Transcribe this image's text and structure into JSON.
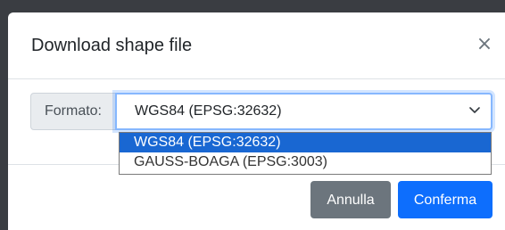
{
  "modal": {
    "title": "Download shape file",
    "close_symbol": "×"
  },
  "form": {
    "format_label": "Formato:",
    "selected_value": "WGS84 (EPSG:32632)",
    "options": [
      {
        "label": "WGS84 (EPSG:32632)",
        "selected": true
      },
      {
        "label": "GAUSS-BOAGA (EPSG:3003)",
        "selected": false
      }
    ]
  },
  "footer": {
    "cancel_label": "Annulla",
    "confirm_label": "Conferma"
  },
  "icons": {
    "close": "close-icon",
    "dropdown": "chevron-down-icon"
  },
  "colors": {
    "primary": "#0d6efd",
    "secondary": "#6c757d",
    "option_highlight": "#1967d2",
    "focus_border": "#86b7fe"
  }
}
